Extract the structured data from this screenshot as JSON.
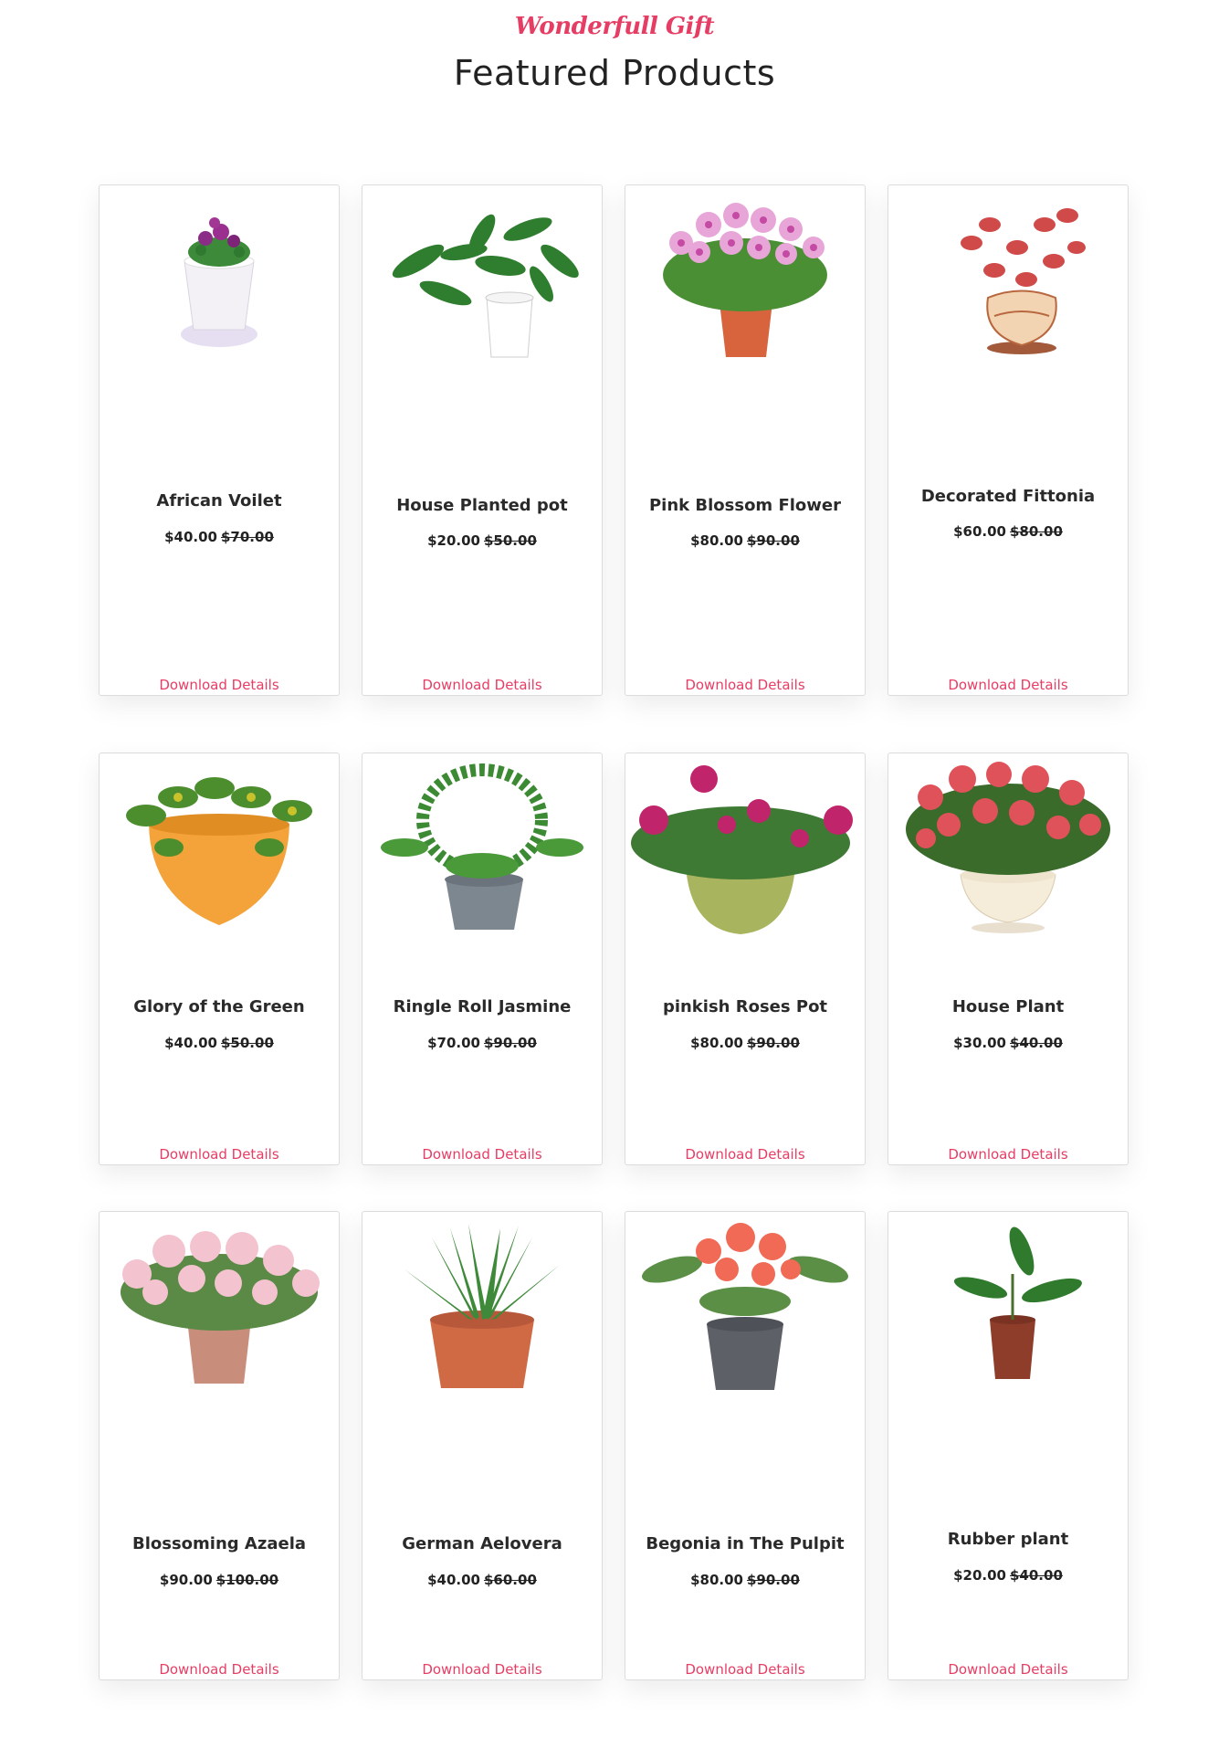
{
  "header": {
    "tagline": "Wonderfull Gift",
    "title": "Featured Products"
  },
  "accent_color": "#e63d64",
  "products": [
    {
      "name": "African Voilet",
      "price": "$40.00",
      "old_price": "$70.00",
      "link": "Download Details",
      "image": "african-violet-plant-image"
    },
    {
      "name": "House Planted pot",
      "price": "$20.00",
      "old_price": "$50.00",
      "link": "Download Details",
      "image": "house-planted-pot-image"
    },
    {
      "name": "Pink Blossom Flower",
      "price": "$80.00",
      "old_price": "$90.00",
      "link": "Download Details",
      "image": "pink-blossom-flower-image"
    },
    {
      "name": "Decorated Fittonia",
      "price": "$60.00",
      "old_price": "$80.00",
      "link": "Download Details",
      "image": "decorated-fittonia-image"
    },
    {
      "name": "Glory of the Green",
      "price": "$40.00",
      "old_price": "$50.00",
      "link": "Download Details",
      "image": "glory-of-the-green-image"
    },
    {
      "name": "Ringle Roll Jasmine",
      "price": "$70.00",
      "old_price": "$90.00",
      "link": "Download Details",
      "image": "ringle-roll-jasmine-image"
    },
    {
      "name": "pinkish Roses Pot",
      "price": "$80.00",
      "old_price": "$90.00",
      "link": "Download Details",
      "image": "pinkish-roses-pot-image"
    },
    {
      "name": "House Plant",
      "price": "$30.00",
      "old_price": "$40.00",
      "link": "Download Details",
      "image": "house-plant-image"
    },
    {
      "name": "Blossoming Azaela",
      "price": "$90.00",
      "old_price": "$100.00",
      "link": "Download Details",
      "image": "blossoming-azalea-image"
    },
    {
      "name": "German Aelovera",
      "price": "$40.00",
      "old_price": "$60.00",
      "link": "Download Details",
      "image": "german-aloe-vera-image"
    },
    {
      "name": "Begonia in The Pulpit",
      "price": "$80.00",
      "old_price": "$90.00",
      "link": "Download Details",
      "image": "begonia-in-the-pulpit-image"
    },
    {
      "name": "Rubber plant",
      "price": "$20.00",
      "old_price": "$40.00",
      "link": "Download Details",
      "image": "rubber-plant-image"
    }
  ]
}
